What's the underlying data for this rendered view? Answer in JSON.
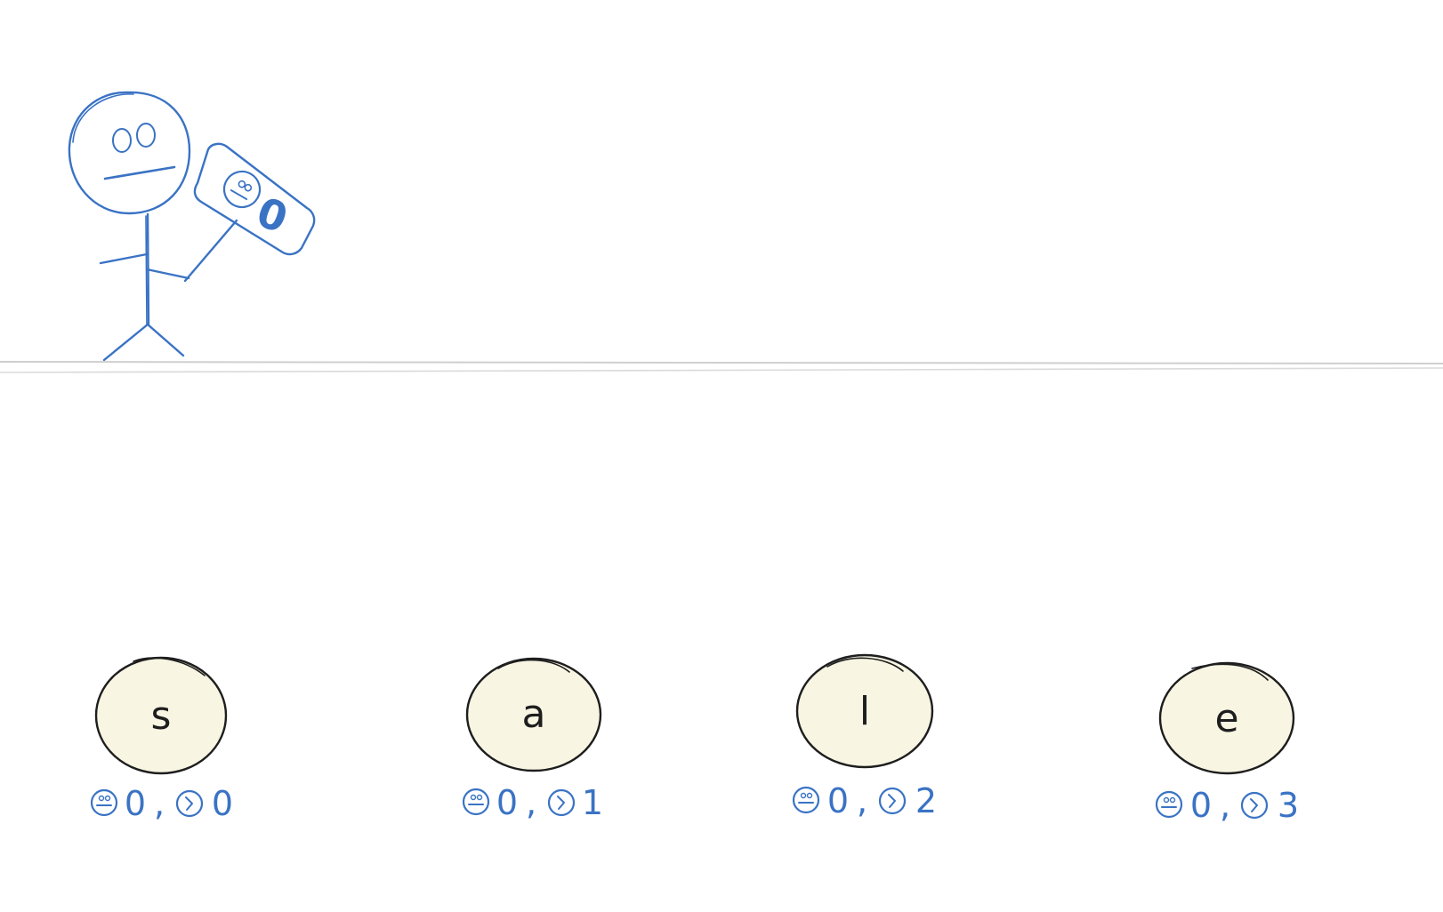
{
  "diagram": {
    "person": {
      "sign_value": "0",
      "sign_icon": "face-icon",
      "stroke_color": "#3a73c4"
    },
    "divider_color": "#cfcfcf",
    "nodes": [
      {
        "letter": "s",
        "face_value": "0",
        "sep": ",",
        "index_value": "0"
      },
      {
        "letter": "a",
        "face_value": "0",
        "sep": ",",
        "index_value": "1"
      },
      {
        "letter": "l",
        "face_value": "0",
        "sep": ",",
        "index_value": "2"
      },
      {
        "letter": "e",
        "face_value": "0",
        "sep": ",",
        "index_value": "3"
      }
    ],
    "node_fill": "#f8f5e3",
    "node_stroke": "#1e1e1e",
    "label_color": "#3a73c4",
    "label_icons": [
      "face-icon",
      "pointer-icon"
    ]
  }
}
